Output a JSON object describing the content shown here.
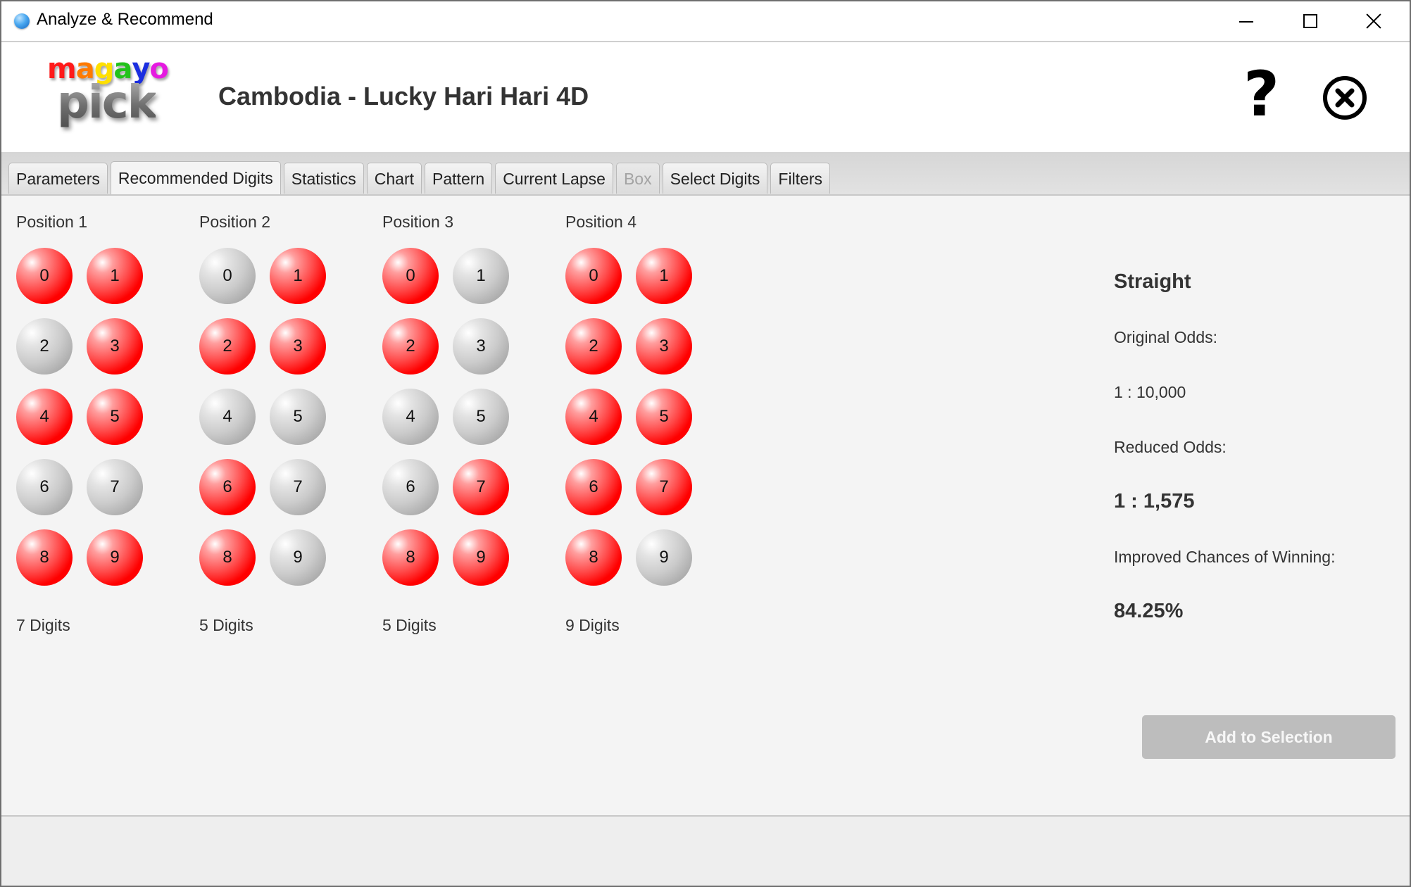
{
  "window": {
    "title": "Analyze & Recommend",
    "icon": "blue-sphere-icon",
    "controls": [
      "minimize",
      "maximize",
      "close"
    ]
  },
  "header": {
    "logo_top": [
      "m",
      "a",
      "g",
      "a",
      "y",
      "o"
    ],
    "logo_top_colors": [
      "#ff1a1a",
      "#ff7a00",
      "#ffe000",
      "#22c21a",
      "#1a2ee0",
      "#e51ae0"
    ],
    "logo_bottom": "pick",
    "game_title": "Cambodia - Lucky Hari Hari 4D",
    "help_icon": "question-mark-icon",
    "close_icon": "circle-x-icon"
  },
  "tabs": [
    {
      "label": "Parameters",
      "state": "normal"
    },
    {
      "label": "Recommended Digits",
      "state": "active"
    },
    {
      "label": "Statistics",
      "state": "normal"
    },
    {
      "label": "Chart",
      "state": "normal"
    },
    {
      "label": "Pattern",
      "state": "normal"
    },
    {
      "label": "Current Lapse",
      "state": "normal"
    },
    {
      "label": "Box",
      "state": "disabled"
    },
    {
      "label": "Select Digits",
      "state": "normal"
    },
    {
      "label": "Filters",
      "state": "normal"
    }
  ],
  "colors": {
    "selected_ball": "#ff0000",
    "unselected_ball": "#ababab",
    "button_disabled": "#bdbdbd"
  },
  "positions": [
    {
      "label": "Position 1",
      "digits": [
        {
          "digit": "0",
          "selected": true
        },
        {
          "digit": "1",
          "selected": true
        },
        {
          "digit": "2",
          "selected": false
        },
        {
          "digit": "3",
          "selected": true
        },
        {
          "digit": "4",
          "selected": true
        },
        {
          "digit": "5",
          "selected": true
        },
        {
          "digit": "6",
          "selected": false
        },
        {
          "digit": "7",
          "selected": false
        },
        {
          "digit": "8",
          "selected": true
        },
        {
          "digit": "9",
          "selected": true
        }
      ],
      "count_label": "7 Digits"
    },
    {
      "label": "Position 2",
      "digits": [
        {
          "digit": "0",
          "selected": false
        },
        {
          "digit": "1",
          "selected": true
        },
        {
          "digit": "2",
          "selected": true
        },
        {
          "digit": "3",
          "selected": true
        },
        {
          "digit": "4",
          "selected": false
        },
        {
          "digit": "5",
          "selected": false
        },
        {
          "digit": "6",
          "selected": true
        },
        {
          "digit": "7",
          "selected": false
        },
        {
          "digit": "8",
          "selected": true
        },
        {
          "digit": "9",
          "selected": false
        }
      ],
      "count_label": "5 Digits"
    },
    {
      "label": "Position 3",
      "digits": [
        {
          "digit": "0",
          "selected": true
        },
        {
          "digit": "1",
          "selected": false
        },
        {
          "digit": "2",
          "selected": true
        },
        {
          "digit": "3",
          "selected": false
        },
        {
          "digit": "4",
          "selected": false
        },
        {
          "digit": "5",
          "selected": false
        },
        {
          "digit": "6",
          "selected": false
        },
        {
          "digit": "7",
          "selected": true
        },
        {
          "digit": "8",
          "selected": true
        },
        {
          "digit": "9",
          "selected": true
        }
      ],
      "count_label": "5 Digits"
    },
    {
      "label": "Position 4",
      "digits": [
        {
          "digit": "0",
          "selected": true
        },
        {
          "digit": "1",
          "selected": true
        },
        {
          "digit": "2",
          "selected": true
        },
        {
          "digit": "3",
          "selected": true
        },
        {
          "digit": "4",
          "selected": true
        },
        {
          "digit": "5",
          "selected": true
        },
        {
          "digit": "6",
          "selected": true
        },
        {
          "digit": "7",
          "selected": true
        },
        {
          "digit": "8",
          "selected": true
        },
        {
          "digit": "9",
          "selected": false
        }
      ],
      "count_label": "9 Digits"
    }
  ],
  "summary": {
    "bet_type": "Straight",
    "original_odds_label": "Original Odds:",
    "original_odds_value": "1 : 10,000",
    "reduced_odds_label": "Reduced Odds:",
    "reduced_odds_value": "1 : 1,575",
    "improved_label": "Improved Chances of Winning:",
    "improved_value": "84.25%"
  },
  "actions": {
    "add_to_selection_label": "Add to Selection",
    "add_to_selection_enabled": false
  }
}
